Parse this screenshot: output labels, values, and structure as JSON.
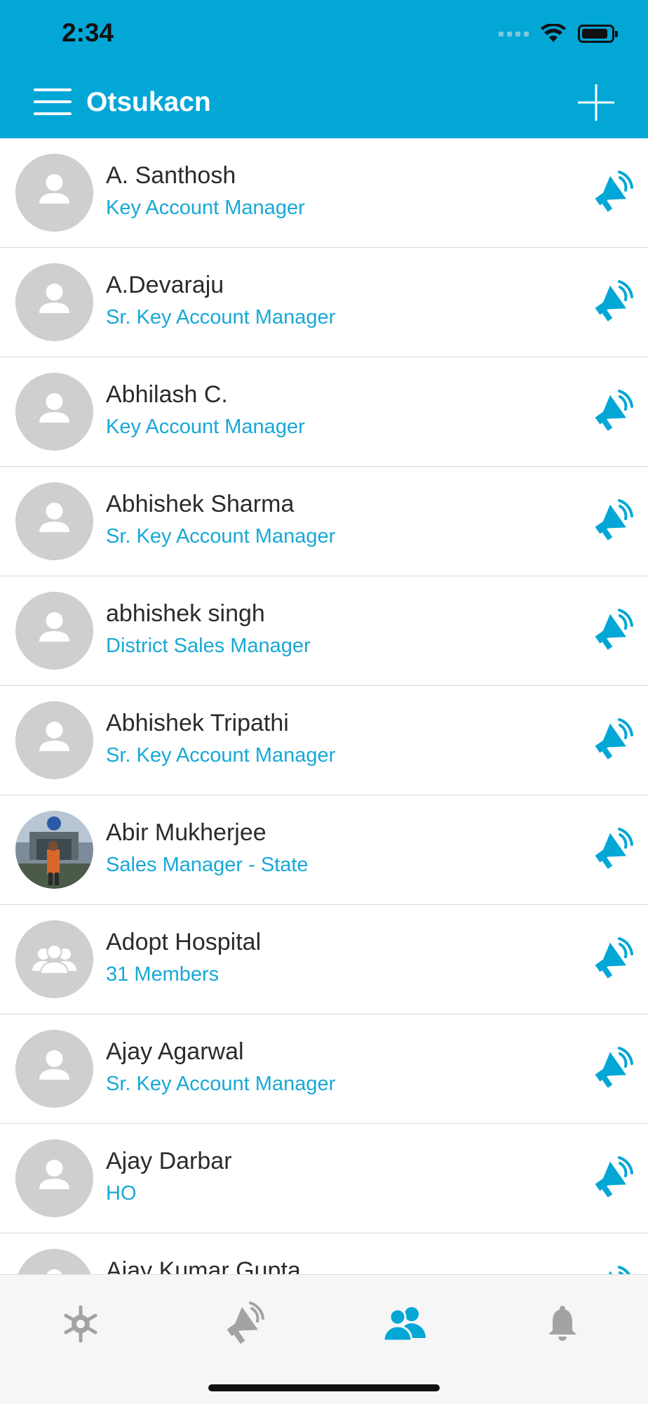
{
  "status_bar": {
    "time": "2:34"
  },
  "header": {
    "title": "Otsukacn"
  },
  "contacts": [
    {
      "name": "A. Santhosh",
      "role": "Key Account Manager",
      "avatar": "person-placeholder"
    },
    {
      "name": "A.Devaraju",
      "role": "Sr. Key Account Manager",
      "avatar": "person-placeholder"
    },
    {
      "name": "Abhilash C.",
      "role": "Key Account Manager",
      "avatar": "person-placeholder"
    },
    {
      "name": "Abhishek Sharma",
      "role": "Sr. Key Account Manager",
      "avatar": "person-placeholder"
    },
    {
      "name": "abhishek singh",
      "role": "District Sales Manager",
      "avatar": "person-placeholder"
    },
    {
      "name": "Abhishek Tripathi",
      "role": "Sr. Key Account Manager",
      "avatar": "person-placeholder"
    },
    {
      "name": "Abir Mukherjee",
      "role": "Sales Manager - State",
      "avatar": "photo"
    },
    {
      "name": "Adopt Hospital",
      "role": "31 Members",
      "avatar": "group-placeholder"
    },
    {
      "name": "Ajay Agarwal",
      "role": "Sr. Key Account Manager",
      "avatar": "person-placeholder"
    },
    {
      "name": "Ajay Darbar",
      "role": "HO",
      "avatar": "person-placeholder"
    },
    {
      "name": "Ajay Kumar Gupta",
      "role": "",
      "avatar": "person-placeholder"
    }
  ],
  "tabs": [
    {
      "icon": "settings-wheel-icon",
      "active": false
    },
    {
      "icon": "broadcast-icon",
      "active": false
    },
    {
      "icon": "contacts-icon",
      "active": true
    },
    {
      "icon": "bell-icon",
      "active": false
    }
  ],
  "colors": {
    "accent": "#02a7d6",
    "subtitle": "#18a8d6",
    "placeholder": "#cfcfcf",
    "inactive_tab": "#a3a3a3"
  }
}
